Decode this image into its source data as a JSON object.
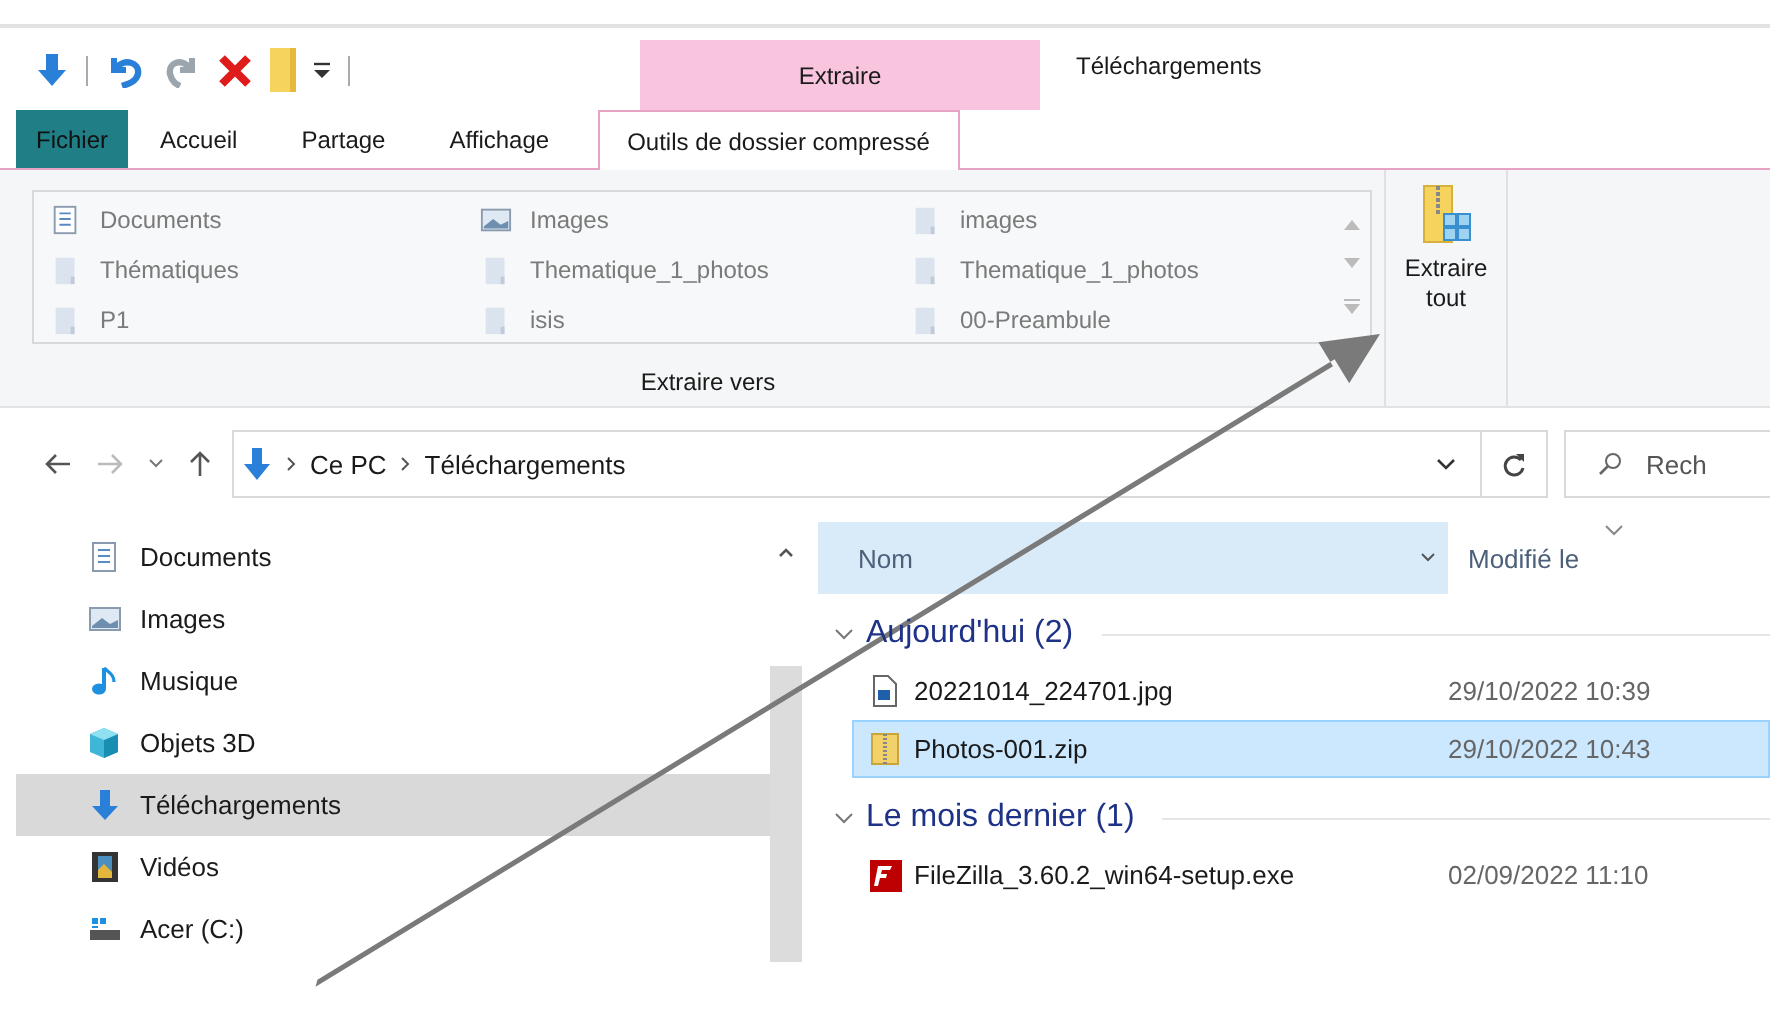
{
  "ribbon": {
    "context_group": "Extraire",
    "window_title": "Téléchargements",
    "tabs": [
      {
        "label": "Fichier",
        "kind": "file",
        "selected": false
      },
      {
        "label": "Accueil",
        "kind": "tab",
        "selected": false
      },
      {
        "label": "Partage",
        "kind": "tab",
        "selected": false
      },
      {
        "label": "Affichage",
        "kind": "tab",
        "selected": false
      },
      {
        "label": "Outils de dossier compressé",
        "kind": "tab",
        "selected": true
      }
    ],
    "destinations": [
      {
        "label": "Documents",
        "kind": "documents"
      },
      {
        "label": "Thématiques",
        "kind": "folder"
      },
      {
        "label": "P1",
        "kind": "folder"
      },
      {
        "label": "Images",
        "kind": "pictures"
      },
      {
        "label": "Thematique_1_photos",
        "kind": "folder"
      },
      {
        "label": "isis",
        "kind": "folder"
      },
      {
        "label": "images",
        "kind": "folder"
      },
      {
        "label": "Thematique_1_photos",
        "kind": "folder"
      },
      {
        "label": "00-Preambule",
        "kind": "folder"
      }
    ],
    "group_label": "Extraire vers",
    "extract_all": "Extraire tout"
  },
  "address_bar": {
    "path": [
      "Ce PC",
      "Téléchargements"
    ]
  },
  "search": {
    "placeholder": "Rech"
  },
  "nav_pane": {
    "items": [
      {
        "label": "Documents",
        "kind": "documents",
        "selected": false
      },
      {
        "label": "Images",
        "kind": "pictures",
        "selected": false
      },
      {
        "label": "Musique",
        "kind": "music",
        "selected": false
      },
      {
        "label": "Objets 3D",
        "kind": "objects3d",
        "selected": false
      },
      {
        "label": "Téléchargements",
        "kind": "downloads",
        "selected": true
      },
      {
        "label": "Vidéos",
        "kind": "videos",
        "selected": false
      },
      {
        "label": "Acer (C:)",
        "kind": "drive",
        "selected": false
      }
    ]
  },
  "file_list": {
    "columns": [
      "Nom",
      "Modifié le"
    ],
    "groups": [
      {
        "title": "Aujourd'hui (2)",
        "expanded": true,
        "files": [
          {
            "name": "20221014_224701.jpg",
            "modified": "29/10/2022 10:39",
            "kind": "image",
            "selected": false
          },
          {
            "name": "Photos-001.zip",
            "modified": "29/10/2022 10:43",
            "kind": "zip",
            "selected": true
          }
        ]
      },
      {
        "title": "Le mois dernier (1)",
        "expanded": true,
        "files": [
          {
            "name": "FileZilla_3.60.2_win64-setup.exe",
            "modified": "02/09/2022 11:10",
            "kind": "filezilla",
            "selected": false
          }
        ]
      }
    ]
  }
}
